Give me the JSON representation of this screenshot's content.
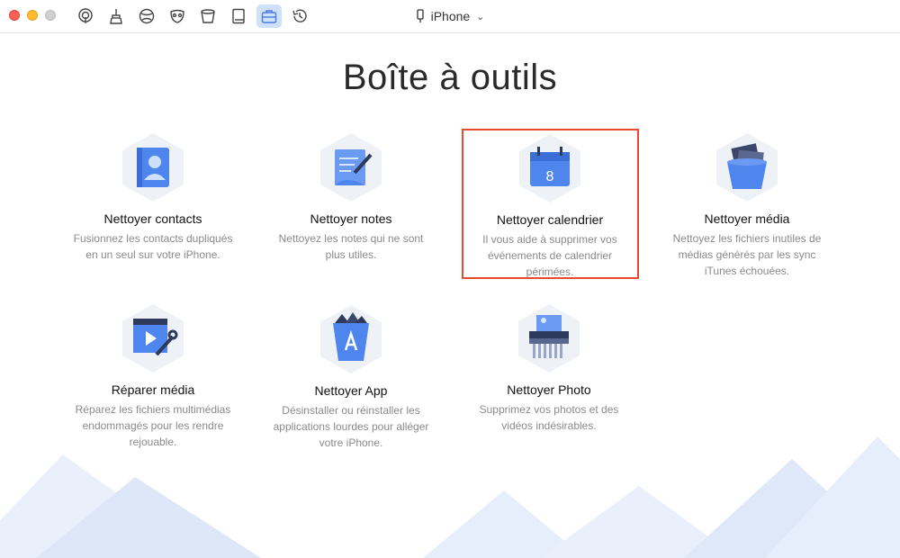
{
  "toolbar": {
    "icons": [
      "podcast-icon",
      "broom-icon",
      "globe-icon",
      "mask-icon",
      "bucket-icon",
      "book-icon",
      "toolbox-icon",
      "history-icon"
    ],
    "active": "toolbox-icon"
  },
  "device": {
    "name": "iPhone"
  },
  "page": {
    "title": "Boîte à outils"
  },
  "tools": [
    {
      "name": "Nettoyer contacts",
      "description": "Fusionnez les contacts dupliqués en un seul sur votre iPhone.",
      "icon": "contacts-icon"
    },
    {
      "name": "Nettoyer notes",
      "description": "Nettoyez les notes qui ne sont plus utiles.",
      "icon": "notes-icon"
    },
    {
      "name": "Nettoyer calendrier",
      "description": "Il vous aide à supprimer vos événements de calendrier périmées.",
      "icon": "calendar-icon",
      "calendar_day": "8"
    },
    {
      "name": "Nettoyer média",
      "description": "Nettoyez les fichiers inutiles de médias générés par les sync iTunes échouées.",
      "icon": "media-bucket-icon"
    },
    {
      "name": "Réparer média",
      "description": "Réparez les fichiers multimédias endommagés pour les rendre rejouable.",
      "icon": "repair-media-icon"
    },
    {
      "name": "Nettoyer App",
      "description": "Désinstaller ou réinstaller les applications lourdes pour alléger votre iPhone.",
      "icon": "app-trash-icon"
    },
    {
      "name": "Nettoyer Photo",
      "description": "Supprimez vos photos et des vidéos indésirables.",
      "icon": "photo-shredder-icon"
    }
  ],
  "colors": {
    "accent": "#5b8ef0",
    "highlight": "#e84a2f",
    "hex_bg": "#eef1f6"
  }
}
